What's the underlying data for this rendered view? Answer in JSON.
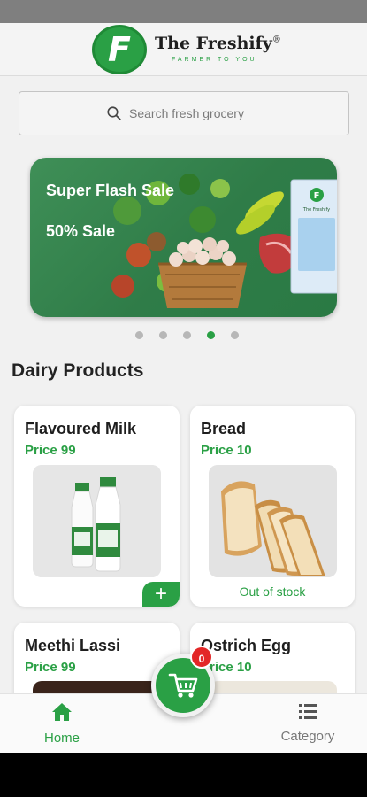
{
  "brand": {
    "logo_letter": "F",
    "name": "The Freshify",
    "registered": "®",
    "tagline": "FARMER TO YOU"
  },
  "search": {
    "placeholder": "Search fresh grocery"
  },
  "banner": {
    "title": "Super Flash Sale",
    "subtitle": "50% Sale",
    "product_label": "The Freshify",
    "total_slides": 5,
    "active_slide": 4
  },
  "section": {
    "title": "Dairy Products"
  },
  "products": [
    {
      "name": "Flavoured Milk",
      "price": "Price 99",
      "action": "+"
    },
    {
      "name": "Bread",
      "price": "Price 10",
      "status": "Out of stock"
    },
    {
      "name": "Meethi Lassi",
      "price": "Price 99"
    },
    {
      "name": "Ostrich Egg",
      "price": "Price 10"
    }
  ],
  "cart": {
    "count": "0"
  },
  "nav": {
    "home": "Home",
    "category": "Category"
  },
  "colors": {
    "accent": "#2aa045",
    "badge": "#e32727"
  }
}
